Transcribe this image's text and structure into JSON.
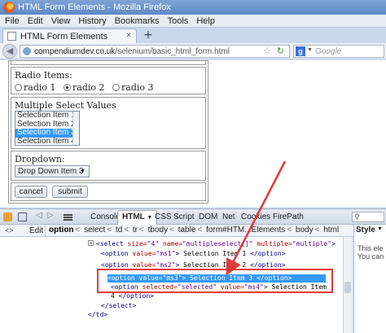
{
  "window": {
    "title": "HTML Form Elements - Mozilla Firefox"
  },
  "menubar": {
    "items": [
      "File",
      "Edit",
      "View",
      "History",
      "Bookmarks",
      "Tools",
      "Help"
    ]
  },
  "tab": {
    "label": "HTML Form Elements",
    "close": "×",
    "new_tab": "+"
  },
  "navbar": {
    "url_host": "compendiumdev.co.uk",
    "url_path": "/selenium/basic_html_form.html",
    "search_placeholder": "Google",
    "search_engine_letter": "g"
  },
  "form": {
    "radio_label": "Radio Items:",
    "radios": [
      {
        "label": "radio 1",
        "checked": false
      },
      {
        "label": "radio 2",
        "checked": true
      },
      {
        "label": "radio 3",
        "checked": false
      }
    ],
    "multi_label": "Multiple Select Values",
    "multi_options": [
      {
        "label": "Selection Item 1",
        "selected": false
      },
      {
        "label": "Selection Item 2",
        "selected": false
      },
      {
        "label": "Selection Item 3",
        "selected": true
      },
      {
        "label": "Selection Item 4",
        "selected": false
      }
    ],
    "dropdown_label": "Dropdown:",
    "dropdown_value": "Drop Down Item 3",
    "cancel_label": "cancel",
    "submit_label": "submit"
  },
  "devtools": {
    "tabs": [
      "Console",
      "HTML",
      "CSS",
      "Script",
      "DOM",
      "Net",
      "Cookies",
      "FirePath"
    ],
    "active_tab": "HTML",
    "edit_label": "Edit",
    "breadcrumbs": [
      "option",
      "select",
      "td",
      "tr",
      "tbody",
      "table",
      "form#HTM...Elements",
      "body",
      "html"
    ],
    "side_tab": "Style",
    "side_lines": [
      "This ele",
      "You can"
    ],
    "code": {
      "select_open": {
        "tag_open": "<select",
        "a1": " size=",
        "v1": "\"4\"",
        "a2": " name=",
        "v2": "\"multipleselect[]\"",
        "a3": " multiple=",
        "v3": "\"multiple\"",
        "tag_close": ">"
      },
      "opt1": {
        "pre": "<option",
        "a": " value=",
        "v": "\"ms1\"",
        "post": ">",
        "text": " Selection Item 1 ",
        "end": "</option>"
      },
      "opt2": {
        "pre": "<option",
        "a": " value=",
        "v": "\"ms2\"",
        "post": ">",
        "text": " Selection Item 2 ",
        "end": "</option>"
      },
      "opt3": {
        "pre": "<option",
        "a": " value=",
        "v": "\"ms3\"",
        "post": ">",
        "text": " Selection Item 3 ",
        "end": "</option>"
      },
      "opt4": {
        "pre": "<option",
        "a1": " selected=",
        "v1": "\"selected\"",
        "a2": " value=",
        "v2": "\"ms4\"",
        "post": ">",
        "text": " Selection Item"
      },
      "opt4_cont": {
        "text": "4 ",
        "end": "</option>"
      },
      "select_close": "</select>",
      "td_close": "</td>"
    }
  },
  "colors": {
    "highlight": "#3399ff",
    "annotation": "#e23a3a"
  }
}
